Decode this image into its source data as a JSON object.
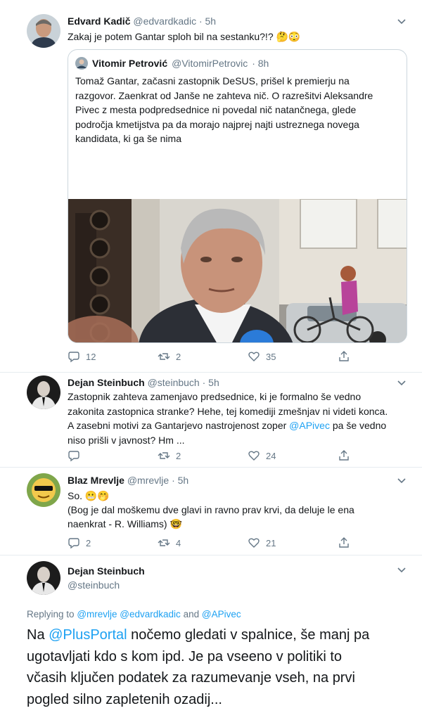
{
  "tweet1": {
    "name": "Edvard Kadič",
    "handle": "@edvardkadic",
    "time": "· 5h",
    "text": "Zakaj je potem Gantar sploh bil na sestanku?!? 🤔😳",
    "quote": {
      "name": "Vitomir Petrović",
      "handle": "@VitomirPetrovic",
      "time": "· 8h",
      "lines": [
        "Tomaž Gantar, začasni zastopnik DeSUS, prišel k premierju na",
        "razgovor. Zaenkrat od Janše ne zahteva nič. O razrešitvi Aleksandre",
        "Pivec z mesta podpredsednice ni povedal nič natančnega, glede",
        "področja kmetijstva pa da morajo najprej najti ustreznega novega",
        "kandidata, ki ga še nima"
      ]
    },
    "replies": "12",
    "retweets": "2",
    "likes": "35"
  },
  "tweet2": {
    "name": "Dejan Steinbuch",
    "handle": "@steinbuch",
    "time": "· 5h",
    "line1": "Zastopnik zahteva zamenjavo predsednice, ki je formalno še vedno",
    "line2": "zakonita zastopnica stranke? Hehe, tej komediji zmešnjav ni videti konca.",
    "line3_pre": "A zasebni motivi za Gantarjevo nastrojenost zoper ",
    "line3_link": "@APivec",
    "line3_post": " pa še vedno",
    "line4": "niso prišli v javnost? Hm ...",
    "replies": "",
    "retweets": "2",
    "likes": "24"
  },
  "tweet3": {
    "name": "Blaz Mrevlje",
    "handle": "@mrevlje",
    "time": "· 5h",
    "line1": "So. 😬🤭",
    "line2": "(Bog je dal moškemu dve glavi in ravno prav krvi, da deluje le ena",
    "line3": "naenkrat - R. Williams) 🤓",
    "replies": "2",
    "retweets": "4",
    "likes": "21"
  },
  "tweet4": {
    "name": "Dejan Steinbuch",
    "handle": "@steinbuch",
    "replying_label": "Replying to",
    "replying_sep1": " ",
    "replying_user1": "@mrevlje",
    "replying_user2": "@edvardkadic",
    "replying_and": "and",
    "replying_user3": "@APivec",
    "big_pre": "Na ",
    "big_link": "@PlusPortal",
    "big_post": " nočemo gledati v spalnice, še manj pa",
    "big_line2": "ugotavljati kdo s kom ipd. Je pa vseeno v politiki to",
    "big_line3": "včasih ključen podatek za razumevanje vseh, na prvi",
    "big_line4": "pogled silno zapletenih ozadij..."
  },
  "colors": {
    "accent": "#1da1f2",
    "muted": "#657786",
    "text": "#14171a",
    "border": "#e6ecf0"
  }
}
